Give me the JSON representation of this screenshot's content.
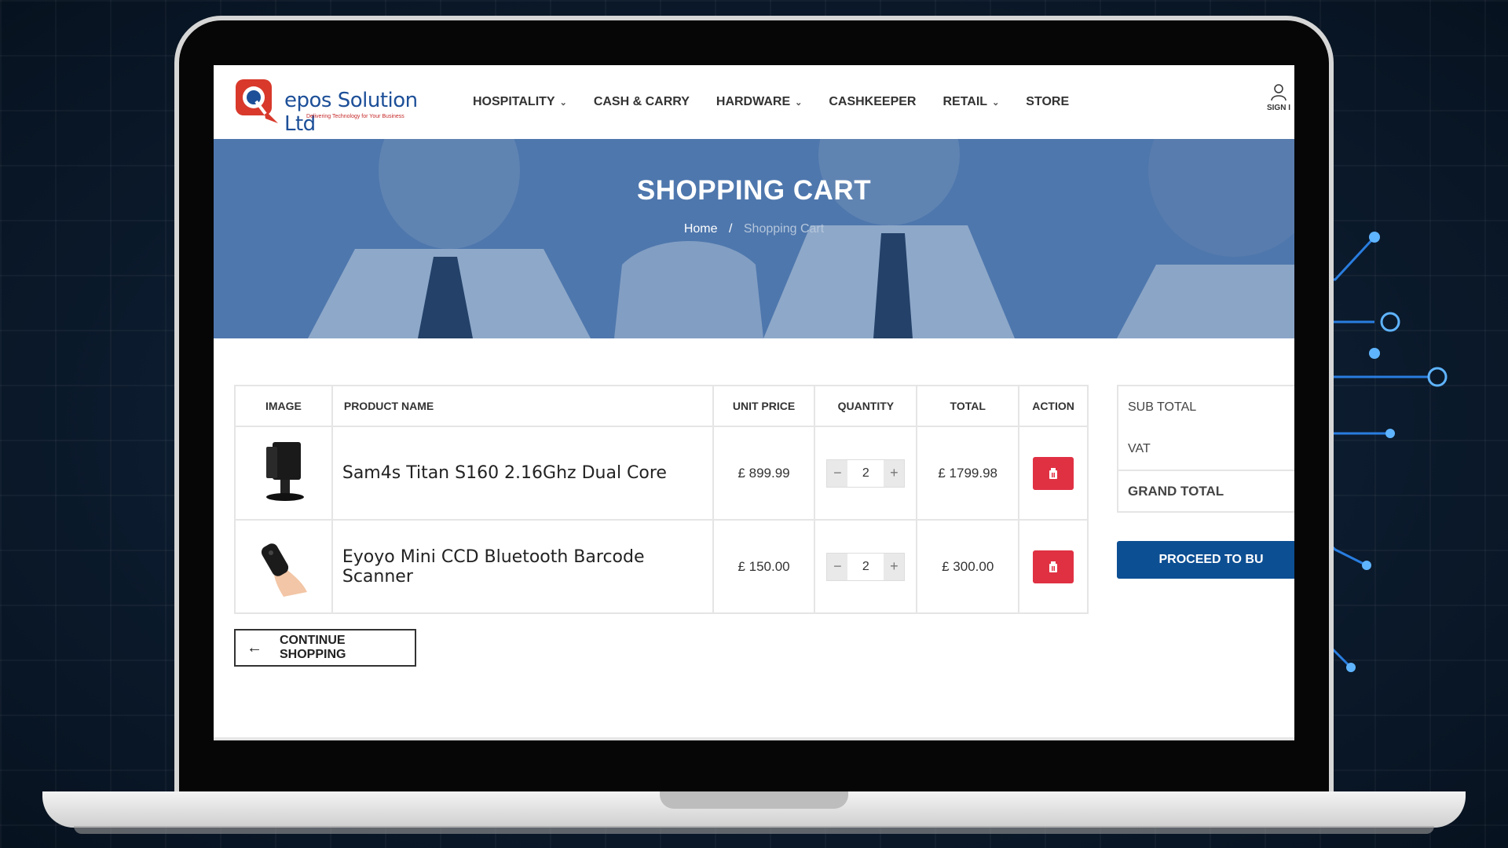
{
  "site": {
    "logo_letter": "Q",
    "logo_text": "epos Solution Ltd",
    "logo_tagline": "Delivering Technology for Your Business"
  },
  "nav": {
    "items": [
      {
        "label": "HOSPITALITY",
        "has_dropdown": true
      },
      {
        "label": "CASH & CARRY",
        "has_dropdown": false
      },
      {
        "label": "HARDWARE",
        "has_dropdown": true
      },
      {
        "label": "CASHKEEPER",
        "has_dropdown": false
      },
      {
        "label": "RETAIL",
        "has_dropdown": true
      },
      {
        "label": "STORE",
        "has_dropdown": false
      }
    ],
    "signin_label": "SIGN I",
    "signin_icon": "user-icon"
  },
  "banner": {
    "title": "SHOPPING CART",
    "breadcrumb_home": "Home",
    "breadcrumb_sep": "/",
    "breadcrumb_current": "Shopping Cart"
  },
  "cart": {
    "headers": {
      "image": "IMAGE",
      "product": "PRODUCT NAME",
      "unit_price": "UNIT PRICE",
      "quantity": "QUANTITY",
      "total": "TOTAL",
      "action": "ACTION"
    },
    "items": [
      {
        "name": "Sam4s Titan S160 2.16Ghz Dual Core",
        "unit_price": "£ 899.99",
        "quantity": "2",
        "total": "£ 1799.98",
        "image_icon": "pos-terminal-icon"
      },
      {
        "name": "Eyoyo Mini CCD Bluetooth Barcode Scanner",
        "unit_price": "£ 150.00",
        "quantity": "2",
        "total": "£ 300.00",
        "image_icon": "barcode-scanner-icon"
      }
    ],
    "stepper": {
      "minus": "−",
      "plus": "+"
    },
    "continue_label": "CONTINUE SHOPPING"
  },
  "summary": {
    "sub_total_label": "SUB TOTAL",
    "vat_label": "VAT",
    "grand_total_label": "GRAND TOTAL",
    "proceed_label": "PROCEED TO BU"
  },
  "colors": {
    "brand_blue": "#0d4f93",
    "delete_red": "#e03143"
  }
}
